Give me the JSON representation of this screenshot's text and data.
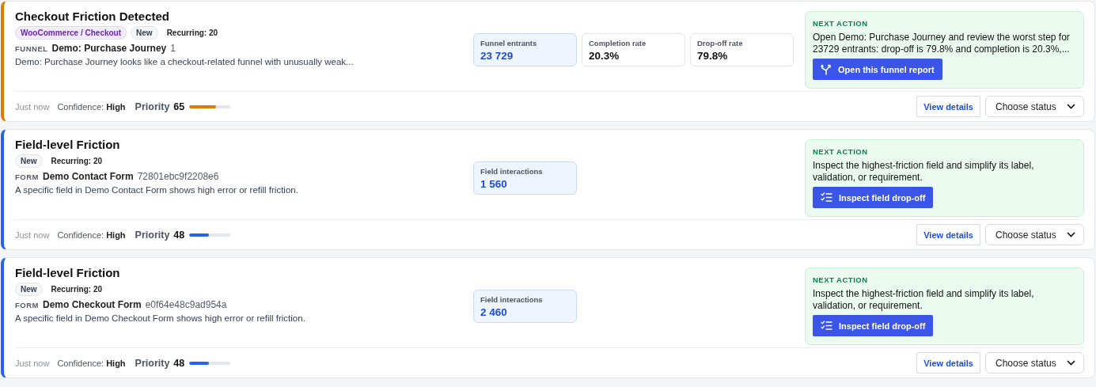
{
  "insights": [
    {
      "color": "#e07b00",
      "title": "Checkout Friction Detected",
      "tags": [
        {
          "kind": "source",
          "label": "WooCommerce / Checkout"
        },
        {
          "kind": "status",
          "label": "New"
        },
        {
          "kind": "plain",
          "label": "Recurring: 20"
        }
      ],
      "entity": {
        "type": "FUNNEL",
        "name": "Demo: Purchase Journey",
        "id": "1"
      },
      "description": "Demo: Purchase Journey looks like a checkout-related funnel with unusually weak...",
      "metrics": [
        {
          "label": "Funnel entrants",
          "value": "23 729",
          "highlighted": true
        },
        {
          "label": "Completion rate",
          "value": "20.3%",
          "highlighted": false
        },
        {
          "label": "Drop-off rate",
          "value": "79.8%",
          "highlighted": false
        }
      ],
      "next_action": {
        "heading": "NEXT ACTION",
        "text": "Open Demo: Purchase Journey and review the worst step for 23729 entrants: drop-off is 79.8% and completion is 20.3%,...",
        "button": {
          "kind": "funnel",
          "label": "Open this funnel report"
        }
      },
      "time": "Just now",
      "confidence_label": "Confidence:",
      "confidence": "High",
      "priority_label": "Priority",
      "priority": "65",
      "level": 0.65,
      "details_button": "View details",
      "status_select": "Choose status"
    },
    {
      "color": "#2563eb",
      "title": "Field-level Friction",
      "tags": [
        {
          "kind": "status",
          "label": "New"
        },
        {
          "kind": "plain",
          "label": "Recurring: 20"
        }
      ],
      "entity": {
        "type": "FORM",
        "name": "Demo Contact Form",
        "id": "72801ebc9f2208e6"
      },
      "description": "A specific field in Demo Contact Form shows high error or refill friction.",
      "metrics": [
        {
          "label": "Field interactions",
          "value": "1 560",
          "highlighted": true
        }
      ],
      "next_action": {
        "heading": "NEXT ACTION",
        "text": "Inspect the highest-friction field and simplify its label, validation, or requirement.",
        "button": {
          "kind": "checklist",
          "label": "Inspect field drop-off"
        }
      },
      "time": "Just now",
      "confidence_label": "Confidence:",
      "confidence": "High",
      "priority_label": "Priority",
      "priority": "48",
      "level": 0.48,
      "details_button": "View details",
      "status_select": "Choose status"
    },
    {
      "color": "#2563eb",
      "title": "Field-level Friction",
      "tags": [
        {
          "kind": "status",
          "label": "New"
        },
        {
          "kind": "plain",
          "label": "Recurring: 20"
        }
      ],
      "entity": {
        "type": "FORM",
        "name": "Demo Checkout Form",
        "id": "e0f64e48c9ad954a"
      },
      "description": "A specific field in Demo Checkout Form shows high error or refill friction.",
      "metrics": [
        {
          "label": "Field interactions",
          "value": "2 460",
          "highlighted": true
        }
      ],
      "next_action": {
        "heading": "NEXT ACTION",
        "text": "Inspect the highest-friction field and simplify its label, validation, or requirement.",
        "button": {
          "kind": "checklist",
          "label": "Inspect field drop-off"
        }
      },
      "time": "Just now",
      "confidence_label": "Confidence:",
      "confidence": "High",
      "priority_label": "Priority",
      "priority": "48",
      "level": 0.48,
      "details_button": "View details",
      "status_select": "Choose status"
    }
  ]
}
